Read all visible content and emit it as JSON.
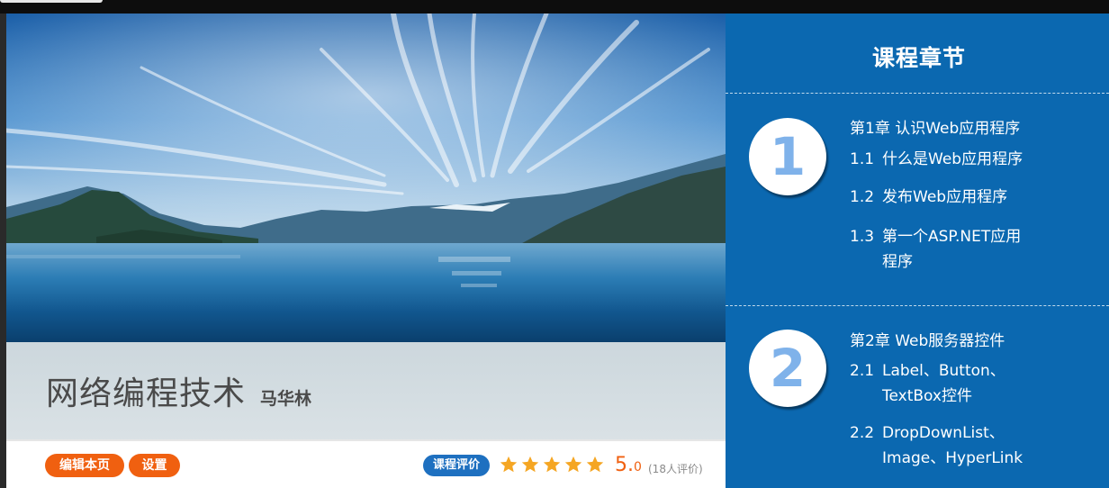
{
  "course": {
    "title": "网络编程技术",
    "teacher": "马华林"
  },
  "actions": {
    "edit_label": "编辑本页",
    "settings_label": "设置"
  },
  "rating": {
    "badge_label": "课程评价",
    "stars": 5,
    "score_int": "5.",
    "score_dec": "0",
    "raters_text": "(18人评价)"
  },
  "chapters_panel": {
    "title": "课程章节",
    "chapters": [
      {
        "number": "1",
        "title": "第1章 认识Web应用程序",
        "sections": [
          {
            "num": "1.1",
            "text": "什么是Web应用程序"
          },
          {
            "num": "1.2",
            "text": "发布Web应用程序"
          },
          {
            "num": "1.3",
            "text": "第一个ASP.NET应用程序"
          }
        ]
      },
      {
        "number": "2",
        "title": "第2章 Web服务器控件",
        "sections": [
          {
            "num": "2.1",
            "text": "Label、Button、TextBox控件"
          },
          {
            "num": "2.2",
            "text": "DropDownList、Image、HyperLink"
          }
        ]
      }
    ]
  },
  "colors": {
    "panel_blue": "#0b68b0",
    "accent_orange": "#f06010",
    "badge_blue": "#1e70c0",
    "star_gold": "#f5a623",
    "circle_digit": "#7fb2ea"
  }
}
